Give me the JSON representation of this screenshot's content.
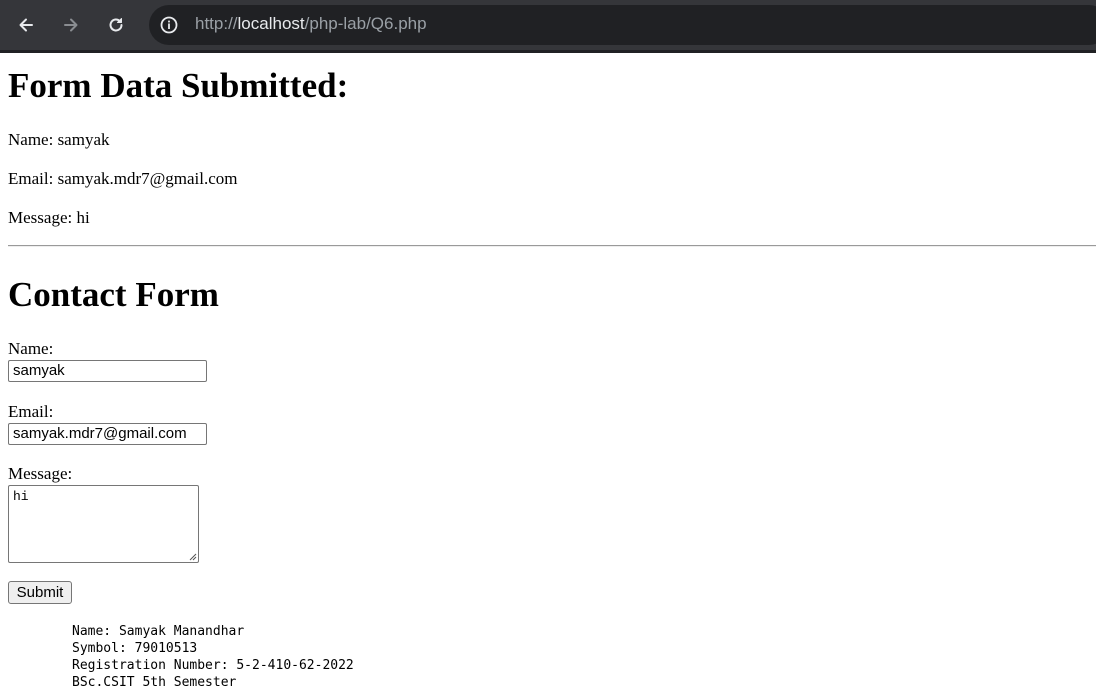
{
  "browser": {
    "url_scheme": "http://",
    "url_host": "localhost",
    "url_path": "/php-lab/Q6.php",
    "icons": [
      "back-arrow-icon",
      "forward-arrow-icon",
      "reload-icon",
      "site-info-icon"
    ]
  },
  "submitted": {
    "heading": "Form Data Submitted:",
    "name_line": "Name: samyak",
    "email_line": "Email: samyak.mdr7@gmail.com",
    "message_line": "Message: hi"
  },
  "form": {
    "heading": "Contact Form",
    "name_label": "Name:",
    "name_value": "samyak",
    "email_label": "Email:",
    "email_value": "samyak.mdr7@gmail.com",
    "message_label": "Message:",
    "message_value": "hi",
    "submit_label": "Submit"
  },
  "footer": {
    "lines": [
      "Name: Samyak Manandhar",
      "Symbol: 79010513",
      "Registration Number: 5-2-410-62-2022",
      "BSc.CSIT 5th Semester"
    ]
  }
}
